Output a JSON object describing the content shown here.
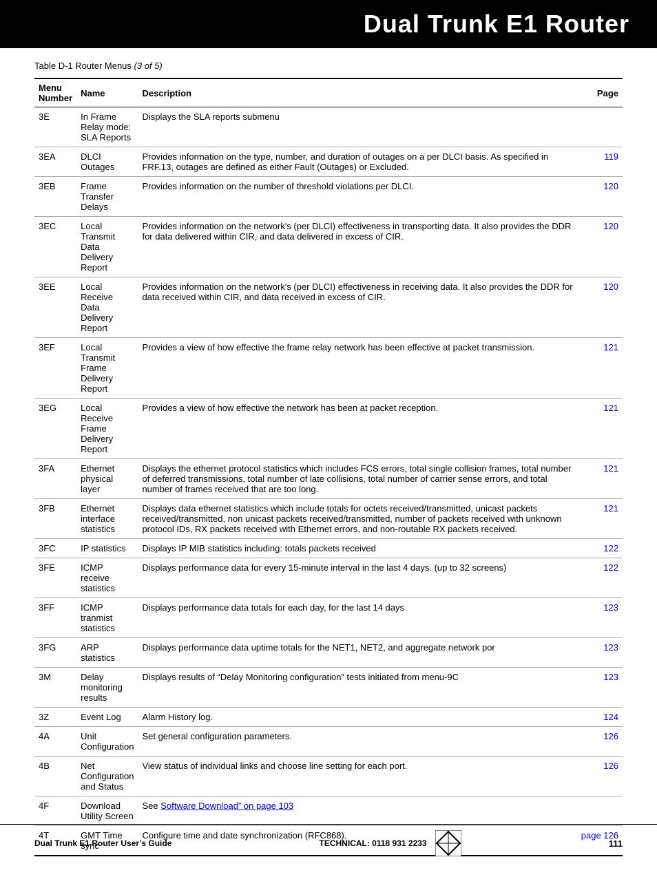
{
  "header": {
    "title": "Dual Trunk E1 Router",
    "bg_color": "#000000",
    "text_color": "#ffffff"
  },
  "table_caption": {
    "label": "Table D-1   Router Menus ",
    "italic_part": "(3 of 5)"
  },
  "table_headers": {
    "menu_number": "Menu\nNumber",
    "name": "Name",
    "description": "Description",
    "page": "Page"
  },
  "rows": [
    {
      "menu": "3E",
      "name": "In Frame Relay mode:\nSLA Reports",
      "description": "Displays the SLA reports submenu",
      "page": "",
      "page_color": ""
    },
    {
      "menu": "3EA",
      "name": "DLCI Outages",
      "description": "Provides information on the type, number, and duration of outages on a per DLCI basis. As specified in FRF.13, outages are defined as either Fault (Outages) or Excluded.",
      "page": "119",
      "page_color": "#0000cc"
    },
    {
      "menu": "3EB",
      "name": "Frame Transfer Delays",
      "description": "Provides information on the number of threshold violations per DLCI.",
      "page": "120",
      "page_color": "#0000cc"
    },
    {
      "menu": "3EC",
      "name": "Local Transmit Data Delivery Report",
      "description": "Provides information on the network's (per DLCI) effectiveness in transporting data. It also provides the DDR for data delivered within CIR, and data delivered in excess of CIR.",
      "page": "120",
      "page_color": "#0000cc"
    },
    {
      "menu": "3EE",
      "name": "Local Receive Data Delivery Report",
      "description": "Provides information on the network's (per DLCI) effectiveness in receiving data. It also provides the DDR for data received within CIR, and data received in excess of CIR.",
      "page": "120",
      "page_color": "#0000cc"
    },
    {
      "menu": "3EF",
      "name": "Local Transmit Frame Delivery Report",
      "description": "Provides a view of how effective the frame relay network has been effective at packet transmission.",
      "page": "121",
      "page_color": "#0000cc"
    },
    {
      "menu": "3EG",
      "name": "Local Receive Frame Delivery Report",
      "description": "Provides a view of how effective the network has been at packet reception.",
      "page": "121",
      "page_color": "#0000cc"
    },
    {
      "menu": "3FA",
      "name": "Ethernet physical layer",
      "description": "Displays the ethernet protocol statistics which includes FCS errors, total single collision frames, total number of deferred transmissions, total number of late collisions, total number of carrier sense errors, and total number of frames received that are too long.",
      "page": "121",
      "page_color": "#0000cc"
    },
    {
      "menu": "3FB",
      "name": "Ethernet interface statistics",
      "description": "Displays data ethernet statistics which include totals for octets received/transmitted, unicast packets received/transmitted, non unicast packets received/transmitted, number of packets received with unknown protocol IDs, RX packets received with Ethernet errors, and non-routable RX packets received.",
      "page": "121",
      "page_color": "#0000cc"
    },
    {
      "menu": "3FC",
      "name": "IP statistics",
      "description": "Displays IP MIB statistics including: totals packets received",
      "page": "122",
      "page_color": "#0000cc"
    },
    {
      "menu": "3FE",
      "name": "ICMP receive statistics",
      "description": "Displays performance data for every 15-minute interval in the last 4 days. (up to 32 screens)",
      "page": "122",
      "page_color": "#0000cc"
    },
    {
      "menu": "3FF",
      "name": "ICMP tranmist statistics",
      "description": "Displays performance data totals for each day, for the last 14 days",
      "page": "123",
      "page_color": "#0000cc"
    },
    {
      "menu": "3FG",
      "name": "ARP statistics",
      "description": "Displays performance data uptime totals for the NET1, NET2, and aggregate network por",
      "page": "123",
      "page_color": "#0000cc"
    },
    {
      "menu": "3M",
      "name": "Delay monitoring results",
      "description": "Displays results of “Delay Monitoring configuration” tests initiated from menu-9C",
      "page": "123",
      "page_color": "#0000cc"
    },
    {
      "menu": "3Z",
      "name": "Event Log",
      "description": "Alarm History log.",
      "page": "124",
      "page_color": "#0000cc"
    },
    {
      "menu": "4A",
      "name": "Unit Configuration",
      "description": "Set general configuration parameters.",
      "page": "126",
      "page_color": "#0000cc"
    },
    {
      "menu": "4B",
      "name": "Net Configuration and Status",
      "description": "View status of individual links and choose line setting for each port.",
      "page": "126",
      "page_color": "#0000cc"
    },
    {
      "menu": "4F",
      "name": "Download Utility Screen",
      "description_pre": "See “",
      "description_link": "Software Download” on page 103",
      "description_post": "",
      "page": "",
      "page_color": "",
      "has_link": true
    },
    {
      "menu": "4T",
      "name": "GMT Time sync",
      "description": "Configure time and date synchronization (RFC868).",
      "page": "page 126",
      "page_color": "#0000cc"
    }
  ],
  "footer": {
    "left": "Dual Trunk E1 Router User’s Guide",
    "center_label": "TECHNICAL:  0118 931 2233",
    "page_number": "111"
  }
}
